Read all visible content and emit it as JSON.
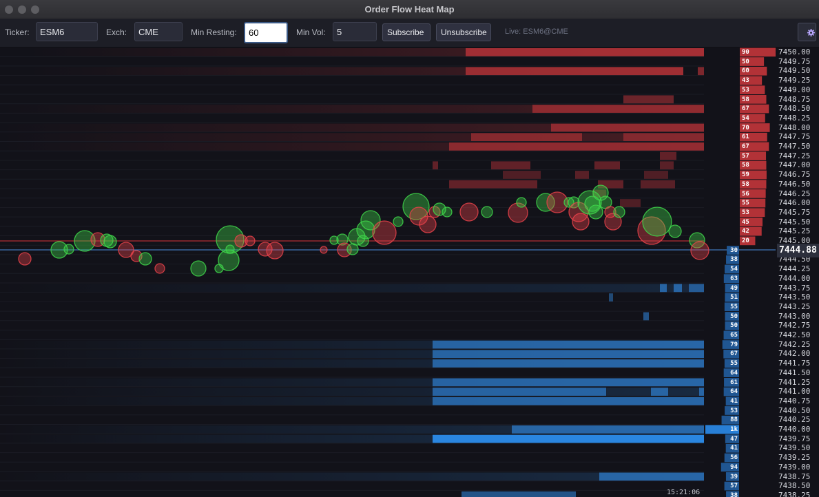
{
  "window": {
    "title": "Order Flow Heat Map"
  },
  "toolbar": {
    "ticker_label": "Ticker:",
    "ticker_value": "ESM6",
    "exch_label": "Exch:",
    "exch_value": "CME",
    "min_resting_label": "Min Resting:",
    "min_resting_value": "60",
    "min_vol_label": "Min Vol:",
    "min_vol_value": "5",
    "subscribe_label": "Subscribe",
    "unsubscribe_label": "Unsubscribe",
    "status": "Live: ESM6@CME",
    "settings_icon": "gear-icon"
  },
  "colors": {
    "ask": "#c4363b",
    "bid": "#2f7fd0",
    "buy_bubble": "#3fd64a",
    "sell_bubble": "#e8424a",
    "background": "#121219"
  },
  "ladder": {
    "asks": [
      {
        "price": "7450.00",
        "size": "90"
      },
      {
        "price": "7449.75",
        "size": "50"
      },
      {
        "price": "7449.50",
        "size": "60"
      },
      {
        "price": "7449.25",
        "size": "43"
      },
      {
        "price": "7449.00",
        "size": "53"
      },
      {
        "price": "7448.75",
        "size": "58"
      },
      {
        "price": "7448.50",
        "size": "67"
      },
      {
        "price": "7448.25",
        "size": "54"
      },
      {
        "price": "7448.00",
        "size": "70"
      },
      {
        "price": "7447.75",
        "size": "61"
      },
      {
        "price": "7447.50",
        "size": "67"
      },
      {
        "price": "7447.25",
        "size": "57"
      },
      {
        "price": "7447.00",
        "size": "58"
      },
      {
        "price": "7446.75",
        "size": "59"
      },
      {
        "price": "7446.50",
        "size": "58"
      },
      {
        "price": "7446.25",
        "size": "56"
      },
      {
        "price": "7446.00",
        "size": "55"
      },
      {
        "price": "7445.75",
        "size": "53"
      },
      {
        "price": "7445.50",
        "size": "45"
      },
      {
        "price": "7445.25",
        "size": "42"
      },
      {
        "price": "7445.00",
        "size": "20"
      }
    ],
    "bids": [
      {
        "price": "",
        "size": "30"
      },
      {
        "price": "7444.50",
        "size": "38"
      },
      {
        "price": "7444.25",
        "size": "54"
      },
      {
        "price": "7444.00",
        "size": "63"
      },
      {
        "price": "7443.75",
        "size": "49"
      },
      {
        "price": "7443.50",
        "size": "51"
      },
      {
        "price": "7443.25",
        "size": "55"
      },
      {
        "price": "7443.00",
        "size": "50"
      },
      {
        "price": "7442.75",
        "size": "50"
      },
      {
        "price": "7442.50",
        "size": "65"
      },
      {
        "price": "7442.25",
        "size": "79"
      },
      {
        "price": "7442.00",
        "size": "67"
      },
      {
        "price": "7441.75",
        "size": "55"
      },
      {
        "price": "7441.50",
        "size": "64"
      },
      {
        "price": "7441.25",
        "size": "61"
      },
      {
        "price": "7441.00",
        "size": "64"
      },
      {
        "price": "7440.75",
        "size": "41"
      },
      {
        "price": "7440.50",
        "size": "53"
      },
      {
        "price": "7440.25",
        "size": "88"
      },
      {
        "price": "7440.00",
        "size": "1k"
      },
      {
        "price": "7439.75",
        "size": "47"
      },
      {
        "price": "7439.50",
        "size": "41"
      },
      {
        "price": "7439.25",
        "size": "56"
      },
      {
        "price": "7439.00",
        "size": "94"
      },
      {
        "price": "7438.75",
        "size": "39"
      },
      {
        "price": "7438.50",
        "size": "57"
      },
      {
        "price": "7438.25",
        "size": "38"
      }
    ],
    "last_price": "7444.88"
  },
  "timestamp": "15:21:06"
}
